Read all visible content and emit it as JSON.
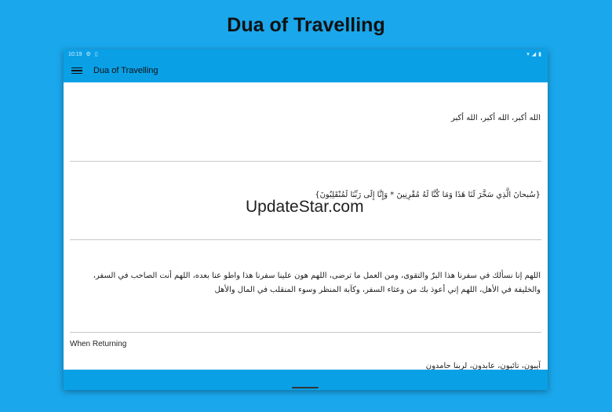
{
  "page_title": "Dua of Travelling",
  "status_bar": {
    "time": "10:19",
    "left_icons": [
      "settings-icon",
      "sim-icon"
    ],
    "right_icons": [
      "wifi-icon",
      "signal-icon",
      "battery-icon"
    ]
  },
  "app_bar": {
    "title": "Dua of Travelling",
    "menu_icon": "hamburger-menu-icon"
  },
  "content": {
    "duas": [
      "الله أكبر، الله أكبر، الله أكبر",
      "{سُبحانَ الَّذِي سَخَّرَ لَنَا هَذَا وَمَا كُنَّا لَهُ مُقْرِنِينَ * وَإِنَّا إِلَى رَبِّنَا لَمُنْقَلِبُونَ}",
      "اللهم إنا نسألك في سفرنا هذا البرّ والتقوى، ومن العمل ما ترضى، اللهم هون علينا سفرنا هذا واطو عنا بعده، اللهم أنت الصاحب في السفر، والخليفة في الأهل، اللهم إني أعوذ بك من وعثاء السفر، وكآبة المنظر وسوء المنقلب في المال والأهل"
    ],
    "returning_heading": "When Returning",
    "returning_dua": "آيبون، تائبون، عابدون، لربنا حامدون"
  },
  "fab": {
    "label": "+",
    "icon": "plus-icon"
  },
  "watermark": "UpdateStar.com",
  "colors": {
    "background": "#1aa7ec",
    "app_bar": "#0aa0e6",
    "divider": "#c8c8c8"
  }
}
